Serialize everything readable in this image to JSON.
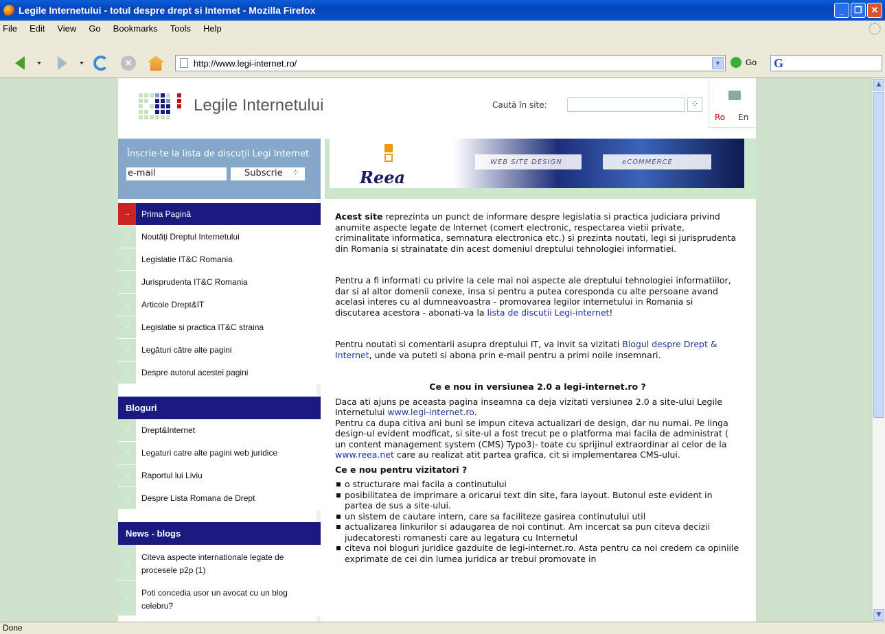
{
  "window": {
    "title": "Legile Internetului - totul despre drept si Internet - Mozilla Firefox"
  },
  "menu": [
    "File",
    "Edit",
    "View",
    "Go",
    "Bookmarks",
    "Tools",
    "Help"
  ],
  "toolbar": {
    "url": "http://www.legi-internet.ro/",
    "go_label": "Go"
  },
  "status": "Done",
  "site": {
    "logo_text": "Legile Internetului",
    "search_label": "Caută în site:",
    "search_placeholder": "",
    "lang_ro": "Ro",
    "lang_en": "En"
  },
  "subscribe": {
    "heading": "Înscrie-te la lista de discuţii Legi Internet",
    "email_value": "e-mail",
    "button_label": "Subscrie"
  },
  "nav": [
    "Prima Pagină",
    "Noutăţi Dreptul Internetului",
    "Legislatie IT&C Romania",
    "Jurisprudenta IT&C Romania",
    "Articole Drept&IT",
    "Legislatie si practica IT&C straina",
    "Legături către alte pagini",
    "Despre autorul acestei pagini"
  ],
  "blogs": {
    "heading": "Bloguri",
    "items": [
      "Drept&Internet",
      "Legaturi catre alte pagini web juridice",
      "Raportul lui Liviu",
      "Despre Lista Romana de Drept"
    ]
  },
  "news": {
    "heading": "News - blogs",
    "items": [
      "Citeva aspecte internationale legate de procesele p2p (1)",
      "Poti concedia usor un avocat cu un blog celebru?"
    ]
  },
  "banner": {
    "brand": "Reea",
    "tag1": "WEB SITE DESIGN",
    "tag2": "eCOMMERCE"
  },
  "content": {
    "p1_bold": "Acest site",
    "p1_rest": " reprezinta un punct de informare despre legislatia si practica judiciara privind anumite aspecte legate de Internet (comert electronic, respectarea vietii private, criminalitate informatica, semnatura electronica etc.) si prezinta noutati, legi si jurisprudenta din Romania si strainatate din acest domeniul dreptului tehnologiei informatiei.",
    "p2_text": "Pentru a fi informati cu privire la cele mai noi aspecte ale dreptului  tehnologiei informatiilor, dar si al altor domenii conexe, insa si pentru a putea coresponda cu alte persoane avand acelasi interes cu al dumneavoastra - promovarea legilor internetului in Romania si discutarea acestora - abonati-va la ",
    "p2_link": "lista de discutii Legi-internet",
    "p2_end": "!",
    "p3_text": "Pentru noutati si comentarii asupra dreptului IT, va invit sa vizitati ",
    "p3_link": "Blogul despre Drept & Internet",
    "p3_end": ", unde va puteti si abona prin e-mail pentru a primi noile insemnari.",
    "h_new": "Ce e nou in versiunea 2.0 a legi-internet.ro ?",
    "p4_a": "Daca ati ajuns pe aceasta pagina inseamna ca deja vizitati versiunea 2.0 a site-ului Legile Internetului ",
    "p4_link": "www.legi-internet.ro",
    "p4_b": ".",
    "p5_a": "Pentru ca dupa citiva ani buni se impun citeva actualizari de design, dar nu numai. Pe linga design-ul evident modficat, si site-ul a fost trecut pe o platforma mai facila de administrat ( un content management system (CMS) Typo3)- toate cu sprijinul extraordinar al celor de la ",
    "p5_link": "www.reea.net",
    "p5_b": " care au realizat atit partea grafica, cit si implementarea CMS-ului.",
    "h_visitors": "Ce e nou pentru vizitatori ?",
    "bullets": [
      "o structurare mai facila a continutului",
      "posibilitatea de imprimare a oricarui text din site, fara layout. Butonul este evident in partea de sus a site-ului.",
      "un sistem de cautare intern, care sa faciliteze gasirea continutului util",
      "actualizarea linkurilor si adaugarea de noi continut. Am incercat sa pun citeva decizii judecatoresti romanesti care au legatura cu Internetul",
      "citeva noi bloguri juridice gazduite de legi-internet.ro. Asta pentru ca noi credem ca opiniile exprimate de cei din lumea juridica ar trebui promovate in"
    ]
  }
}
